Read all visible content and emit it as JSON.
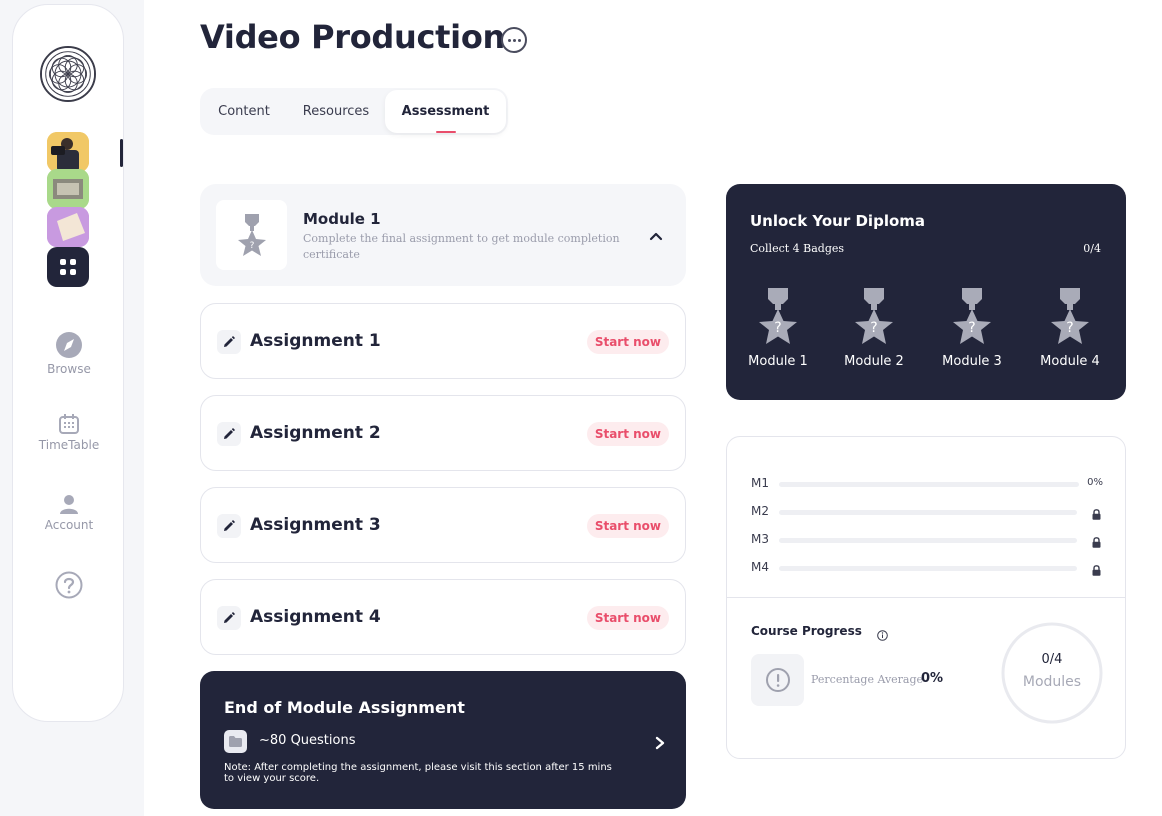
{
  "header": {
    "title": "Video Production"
  },
  "tabs": [
    {
      "label": "Content"
    },
    {
      "label": "Resources"
    },
    {
      "label": "Assessment",
      "active": true
    }
  ],
  "sidebar": {
    "nav": [
      {
        "label": "Browse",
        "icon": "compass-icon"
      },
      {
        "label": "TimeTable",
        "icon": "calendar-icon"
      },
      {
        "label": "Account",
        "icon": "user-icon"
      },
      {
        "label": "",
        "icon": "help-icon"
      }
    ]
  },
  "module": {
    "title": "Module 1",
    "description": "Complete the final assignment to get module completion certificate"
  },
  "assignments": [
    {
      "title": "Assignment 1",
      "action": "Start now"
    },
    {
      "title": "Assignment 2",
      "action": "Start now"
    },
    {
      "title": "Assignment 3",
      "action": "Start now"
    },
    {
      "title": "Assignment 4",
      "action": "Start now"
    }
  ],
  "end_module": {
    "title": "End of Module Assignment",
    "questions": "~80 Questions",
    "note": "Note: After completing the assignment, please visit this section after 15 mins to view your score."
  },
  "diploma": {
    "title": "Unlock Your Diploma",
    "subtitle": "Collect 4 Badges",
    "count": "0/4",
    "badges": [
      "Module 1",
      "Module 2",
      "Module 3",
      "Module 4"
    ]
  },
  "progress": {
    "rows": [
      {
        "label": "M1",
        "value": "0%",
        "fraction": 0,
        "locked": false
      },
      {
        "label": "M2",
        "fraction": 0,
        "locked": true
      },
      {
        "label": "M3",
        "fraction": 0,
        "locked": true
      },
      {
        "label": "M4",
        "fraction": 0,
        "locked": true
      }
    ],
    "course_progress_label": "Course Progress",
    "percentage_average_label": "Percentage Average",
    "percentage_average_value": "0%",
    "modules_value": "0/4",
    "modules_label": "Modules"
  },
  "colors": {
    "accent": "#e94e6b",
    "dark": "#22253a",
    "muted": "#9a9cab"
  }
}
